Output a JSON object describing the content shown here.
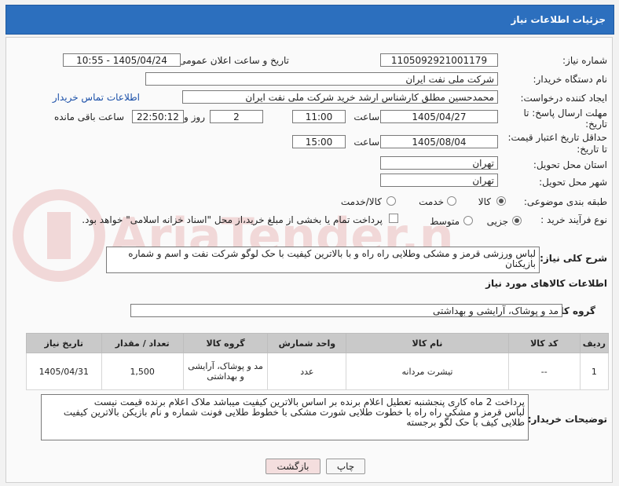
{
  "header": {
    "title": "جزئیات اطلاعات نیاز"
  },
  "fields": {
    "need_number_label": "شماره نیاز:",
    "need_number": "1105092921001179",
    "announce_label": "تاریخ و ساعت اعلان عمومی:",
    "announce_value": "1405/04/24 - 10:55",
    "buyer_org_label": "نام دستگاه خریدار:",
    "buyer_org": "شرکت ملی نفت ایران",
    "creator_label": "ایجاد کننده درخواست:",
    "creator": "محمدحسین مطلق کارشناس ارشد خرید شرکت ملی نفت ایران",
    "buyer_contact_link": "اطلاعات تماس خریدار",
    "reply_deadline_label_1": "مهلت ارسال پاسخ: تا",
    "reply_deadline_label_2": "تاریخ:",
    "reply_date": "1405/04/27",
    "time_label": "ساعت",
    "reply_time": "11:00",
    "days_value": "2",
    "days_label": "روز و",
    "remaining_time": "22:50:12",
    "remaining_label": "ساعت باقی مانده",
    "price_validity_label_1": "حداقل تاریخ اعتبار قیمت:",
    "price_validity_label_2": "تا تاریخ:",
    "price_date": "1405/08/04",
    "price_time": "15:00",
    "province_label": "استان محل تحویل:",
    "province": "تهران",
    "city_label": "شهر محل تحویل:",
    "city": "تهران",
    "category_label": "طبقه بندی موضوعی:",
    "category_options": [
      "کالا",
      "خدمت",
      "کالا/خدمت"
    ],
    "process_label": "نوع فرآیند خرید :",
    "process_options": [
      "جزیی",
      "متوسط"
    ],
    "payment_note": "پرداخت تمام یا بخشی از مبلغ خرید،از محل \"اسناد خزانه اسلامی\" خواهد بود."
  },
  "description": {
    "label": "شرح کلی نیاز:",
    "text": "لباس ورزشی قرمز و مشکی وطلایی راه راه و با بالاترین کیفیت با حک لوگو شرکت نفت و اسم و شماره بازیکنان"
  },
  "goods_info": {
    "heading": "اطلاعات کالاهای مورد نیاز",
    "group_label": "گروه کالا:",
    "group_value": "مد و پوشاک، آرایشی و بهداشتی",
    "columns": [
      "ردیف",
      "کد کالا",
      "نام کالا",
      "واحد شمارش",
      "گروه کالا",
      "تعداد / مقدار",
      "تاریخ نیاز"
    ],
    "rows": [
      {
        "row": "1",
        "code": "--",
        "name": "تیشرت مردانه",
        "unit": "عدد",
        "group": "مد و پوشاک، آرایشی و بهداشتی",
        "qty": "1,500",
        "date": "1405/04/31"
      }
    ]
  },
  "buyer_notes": {
    "label": "توضیحات خریدار:",
    "line1": "پرداخت 2 ماه کاری پنجشنبه تعطیل  اعلام برنده بر اساس بالاترین کیفیت میباشد ملاک اعلام برنده قیمت نیست",
    "line2": "لباس قرمز و مشکی راه راه  با خطوت طلایی  شورت مشکی با خطوط  طلایی  فونت شماره و نام بازیکن بالاترین کیفیت",
    "line3": "طلایی کیف با حک لگو برجسته"
  },
  "buttons": {
    "print": "چاپ",
    "back": "بازگشت"
  },
  "watermark": {
    "text": "AriaTender.net"
  }
}
